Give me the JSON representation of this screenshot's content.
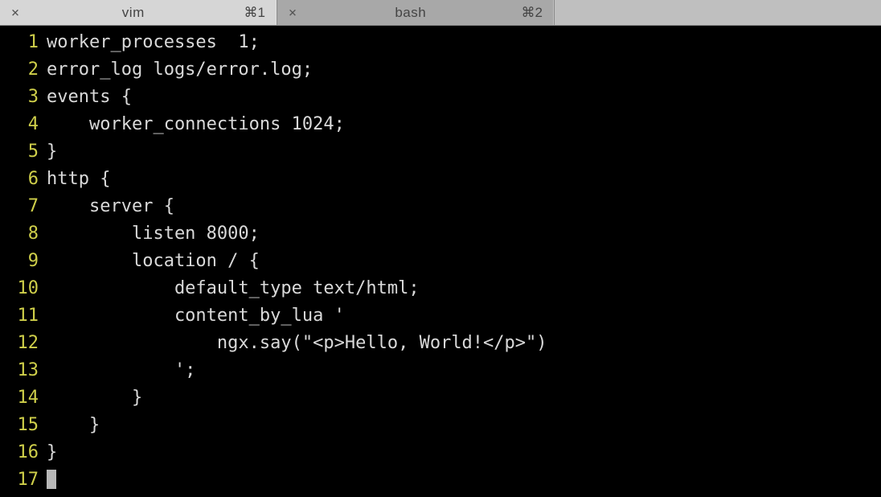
{
  "tabs": [
    {
      "title": "vim",
      "shortcut": "⌘1",
      "active": true
    },
    {
      "title": "bash",
      "shortcut": "⌘2",
      "active": false
    }
  ],
  "close_glyph": "×",
  "editor": {
    "lines": [
      {
        "num": "1",
        "text": "worker_processes  1;"
      },
      {
        "num": "2",
        "text": "error_log logs/error.log;"
      },
      {
        "num": "3",
        "text": "events {"
      },
      {
        "num": "4",
        "text": "    worker_connections 1024;"
      },
      {
        "num": "5",
        "text": "}"
      },
      {
        "num": "6",
        "text": "http {"
      },
      {
        "num": "7",
        "text": "    server {"
      },
      {
        "num": "8",
        "text": "        listen 8000;"
      },
      {
        "num": "9",
        "text": "        location / {"
      },
      {
        "num": "10",
        "text": "            default_type text/html;"
      },
      {
        "num": "11",
        "text": "            content_by_lua '"
      },
      {
        "num": "12",
        "text": "                ngx.say(\"<p>Hello, World!</p>\")"
      },
      {
        "num": "13",
        "text": "            ';"
      },
      {
        "num": "14",
        "text": "        }"
      },
      {
        "num": "15",
        "text": "    }"
      },
      {
        "num": "16",
        "text": "}"
      },
      {
        "num": "17",
        "text": ""
      }
    ],
    "cursor_line_index": 16
  }
}
